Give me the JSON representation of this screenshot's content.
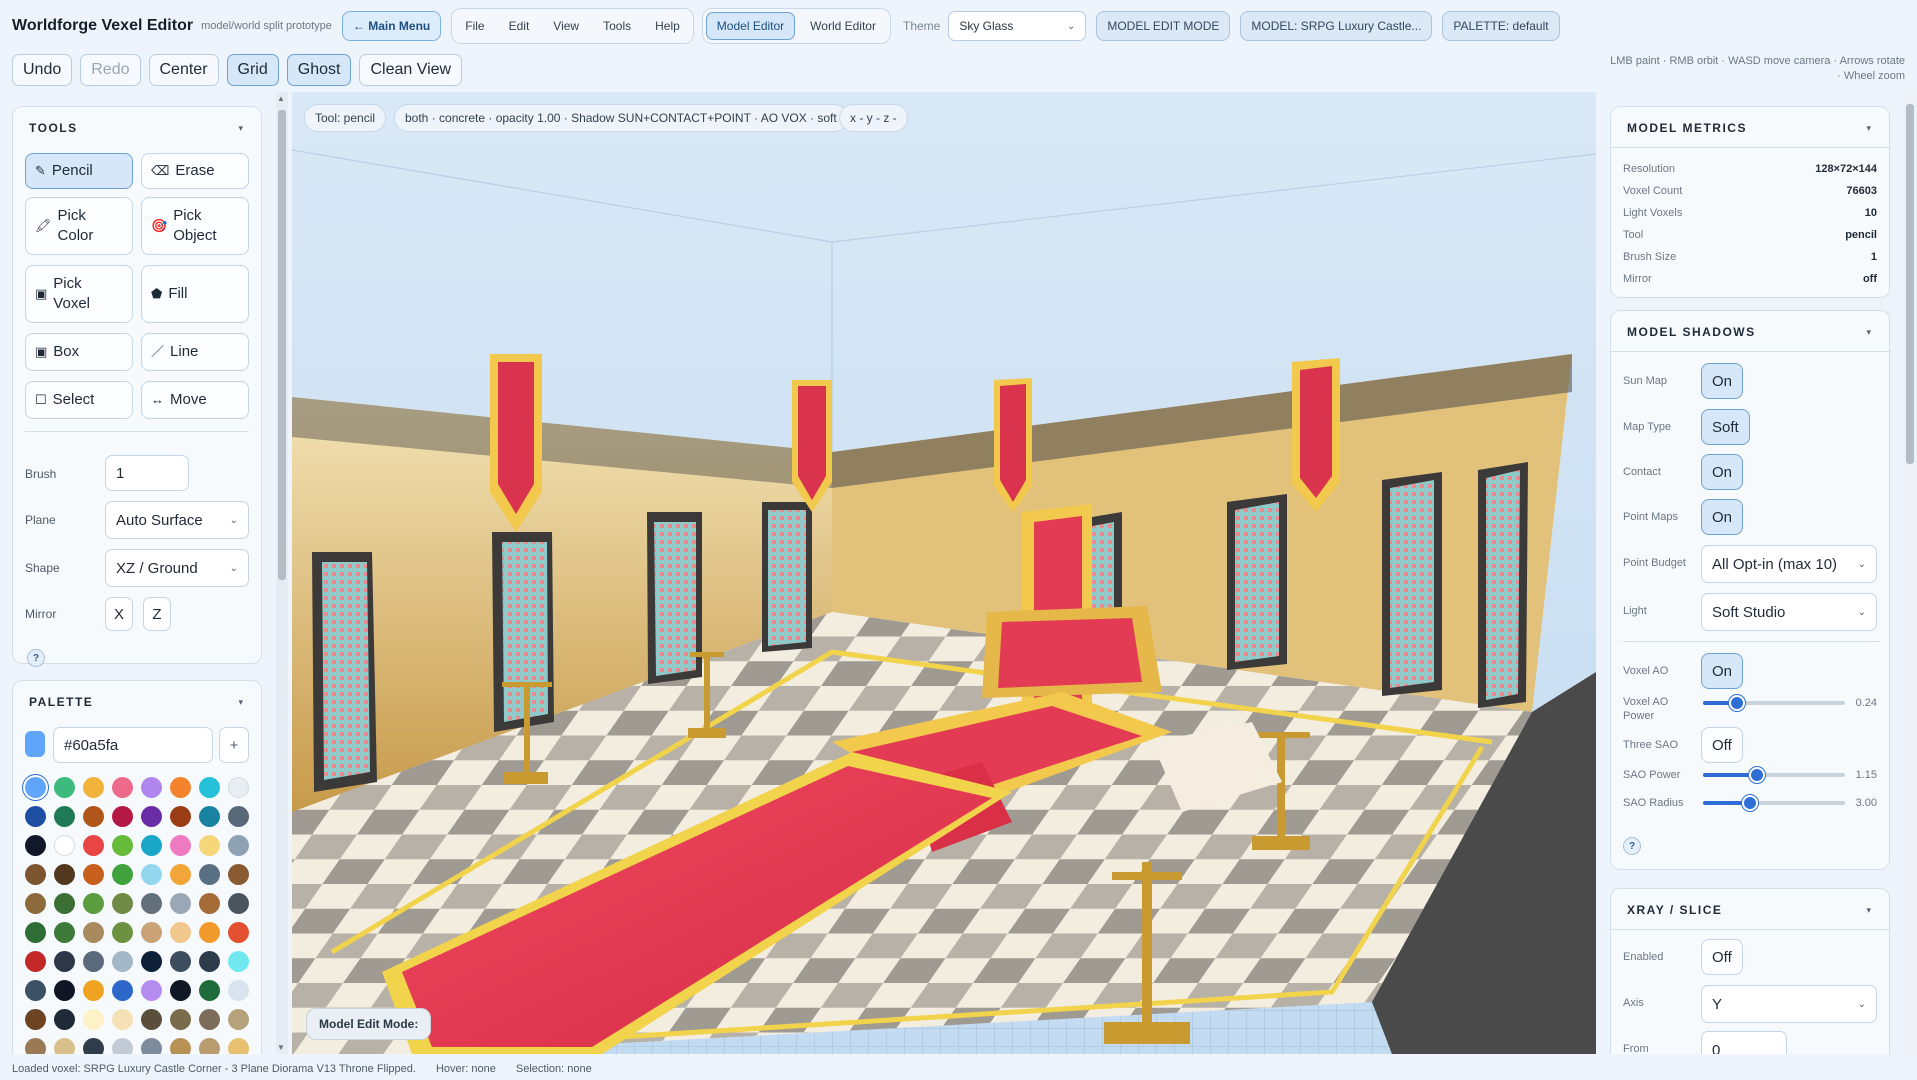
{
  "header": {
    "title": "Worldforge Vexel Editor",
    "subtitle": "model/world split prototype",
    "main_menu": "← Main Menu",
    "menus": [
      "File",
      "Edit",
      "View",
      "Tools",
      "Help"
    ],
    "editor_tabs": [
      "Model Editor",
      "World Editor"
    ],
    "theme_label": "Theme",
    "theme_value": "Sky Glass",
    "mode_tag": "MODEL EDIT MODE",
    "model_tag": "MODEL: SRPG Luxury Castle...",
    "palette_tag": "PALETTE: default"
  },
  "toolbar": {
    "buttons": [
      "Undo",
      "Redo",
      "Center",
      "Grid",
      "Ghost",
      "Clean View"
    ],
    "hint": "LMB paint · RMB orbit · WASD move camera · Arrows rotate · Wheel zoom"
  },
  "tools": {
    "title": "TOOLS",
    "items": [
      {
        "label": "Pencil",
        "icon": "✎"
      },
      {
        "label": "Erase",
        "icon": "⌫"
      },
      {
        "label": "Pick Color",
        "icon": "🖍"
      },
      {
        "label": "Pick Object",
        "icon": "🎯"
      },
      {
        "label": "Pick Voxel",
        "icon": "▣"
      },
      {
        "label": "Fill",
        "icon": "⬟"
      },
      {
        "label": "Box",
        "icon": "▣"
      },
      {
        "label": "Line",
        "icon": "／"
      },
      {
        "label": "Select",
        "icon": "☐"
      },
      {
        "label": "Move",
        "icon": "↔"
      }
    ],
    "brush_label": "Brush",
    "brush_value": "1",
    "plane_label": "Plane",
    "plane_value": "Auto Surface",
    "shape_label": "Shape",
    "shape_value": "XZ / Ground",
    "mirror_label": "Mirror",
    "mirror_x": "X",
    "mirror_z": "Z",
    "help": "?"
  },
  "palette": {
    "title": "PALETTE",
    "hex": "#60a5fa",
    "add": "+",
    "colors": [
      "#60a5fa",
      "#3dbb7f",
      "#f2b33b",
      "#ee6a8a",
      "#b086ee",
      "#f3842d",
      "#25c1d9",
      "#e8edf2",
      "#1e4fa3",
      "#1f7a55",
      "#b0561a",
      "#b41845",
      "#6a2ca6",
      "#9a3d14",
      "#1783a0",
      "#586878",
      "#11182a",
      "#ffffff",
      "#e84545",
      "#66bb3a",
      "#1aa6c8",
      "#ee7bc2",
      "#f5d77a",
      "#8fa2b4",
      "#7d5631",
      "#52381f",
      "#c75f1d",
      "#3fa23c",
      "#93d7ef",
      "#f2a63a",
      "#5a7082",
      "#8a5a32",
      "#8c6a3c",
      "#3c6f34",
      "#5a9c3e",
      "#6e8a45",
      "#62707e",
      "#9aa8b5",
      "#a46b37",
      "#4b5560",
      "#2f6d36",
      "#3d7a3a",
      "#a98a5e",
      "#6c9140",
      "#c9a276",
      "#f1c88b",
      "#f39a2c",
      "#e2502f",
      "#c22827",
      "#2c3848",
      "#5a6a7c",
      "#a4b7c7",
      "#0e1f3a",
      "#3d4d5f",
      "#2d3c4c",
      "#6fe8f0",
      "#3c5163",
      "#0f1626",
      "#f0a321",
      "#2c67c9",
      "#b48cf0",
      "#101826",
      "#1e6c3b",
      "#d7e4ef",
      "#6c4323",
      "#1f2a38",
      "#fdf1c8",
      "#f4e1b5",
      "#5a4e3c",
      "#7a6b4a",
      "#7b6d5a",
      "#b5a27a",
      "#9a7a55",
      "#d8c08a",
      "#2f3c4a",
      "#c2cbd5",
      "#7c8c9c",
      "#b89255",
      "#b99b70",
      "#e8c170"
    ]
  },
  "viewport": {
    "chip_tool": "Tool: pencil",
    "chip_render": "both · concrete · opacity 1.00 · Shadow SUN+CONTACT+POINT · AO VOX · soft",
    "chip_coords": "x - y - z -",
    "mode_label": "Model Edit Mode:"
  },
  "metrics": {
    "title": "MODEL METRICS",
    "rows": [
      {
        "label": "Resolution",
        "value": "128×72×144"
      },
      {
        "label": "Voxel Count",
        "value": "76603"
      },
      {
        "label": "Light Voxels",
        "value": "10"
      },
      {
        "label": "Tool",
        "value": "pencil"
      },
      {
        "label": "Brush Size",
        "value": "1"
      },
      {
        "label": "Mirror",
        "value": "off"
      }
    ]
  },
  "shadows": {
    "title": "MODEL SHADOWS",
    "sun_map_label": "Sun Map",
    "sun_map": "On",
    "map_type_label": "Map Type",
    "map_type": "Soft",
    "contact_label": "Contact",
    "contact": "On",
    "point_maps_label": "Point Maps",
    "point_maps": "On",
    "point_budget_label": "Point Budget",
    "point_budget": "All Opt-in (max 10)",
    "light_label": "Light",
    "light": "Soft Studio",
    "voxel_ao_label": "Voxel AO",
    "voxel_ao": "On",
    "voxel_ao_power_label": "Voxel AO Power",
    "voxel_ao_power": "0.24",
    "voxel_ao_power_pct": 0.24,
    "three_sao_label": "Three SAO",
    "three_sao": "Off",
    "sao_power_label": "SAO Power",
    "sao_power": "1.15",
    "sao_power_pct": 0.38,
    "sao_radius_label": "SAO Radius",
    "sao_radius": "3.00",
    "sao_radius_pct": 0.33,
    "help": "?"
  },
  "xray": {
    "title": "XRAY / SLICE",
    "enabled_label": "Enabled",
    "enabled": "Off",
    "axis_label": "Axis",
    "axis": "Y",
    "from_label": "From",
    "from": "0"
  },
  "status": {
    "loaded": "Loaded voxel: SRPG Luxury Castle Corner - 3 Plane Diorama V13 Throne Flipped.",
    "hover": "Hover: none",
    "selection": "Selection: none"
  },
  "colors": {
    "accent": "#2f6ed6",
    "carpet": "#e23b53",
    "gold": "#f2c94c"
  }
}
